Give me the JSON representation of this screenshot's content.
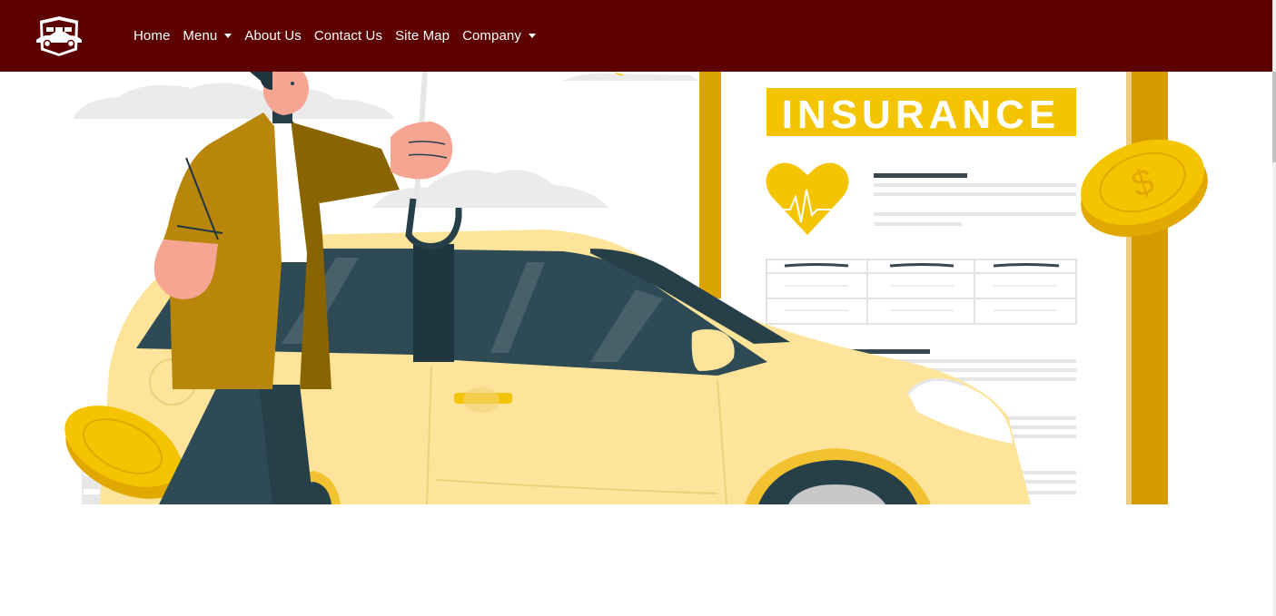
{
  "nav": {
    "logo_icon": "car-shield-logo-icon",
    "items": [
      {
        "label": "Home",
        "dropdown": false
      },
      {
        "label": "Menu",
        "dropdown": true
      },
      {
        "label": "About Us",
        "dropdown": false
      },
      {
        "label": "Contact Us",
        "dropdown": false
      },
      {
        "label": "Site Map",
        "dropdown": false
      },
      {
        "label": "Company",
        "dropdown": true
      }
    ]
  },
  "hero": {
    "sign_text": "INSURANCE",
    "coin_symbol": "$"
  },
  "colors": {
    "navbar": "#5c0000",
    "accent_yellow": "#f5c400",
    "car": "#fde49a",
    "coat": "#b8860b",
    "dark": "#263f48"
  }
}
